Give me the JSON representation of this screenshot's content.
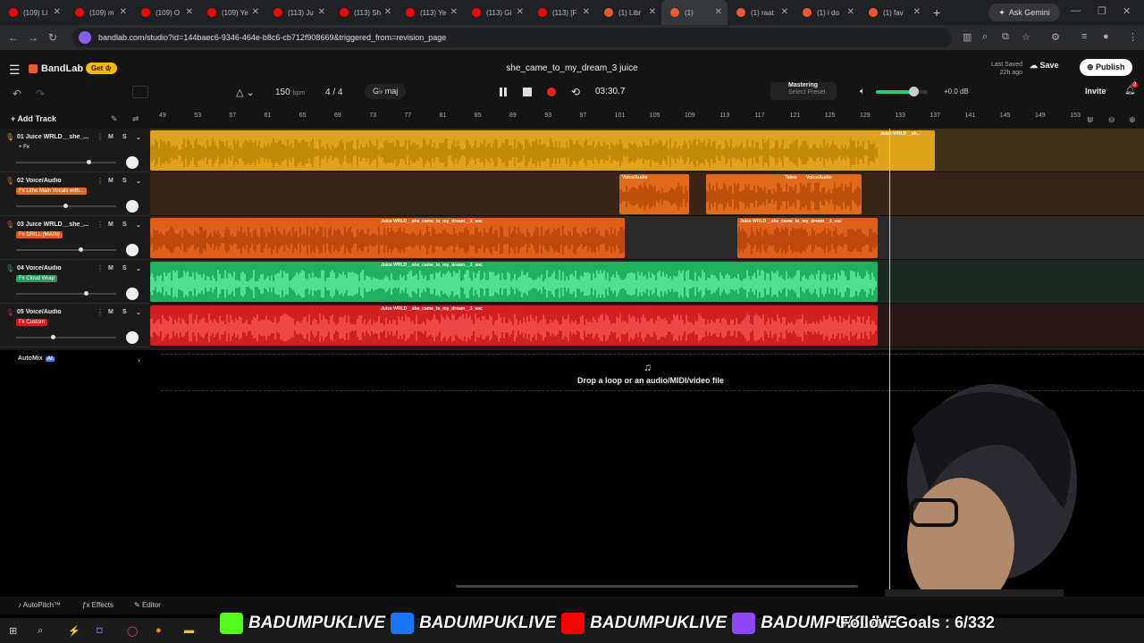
{
  "browser": {
    "tabs": [
      {
        "label": "(109) Li",
        "color": "#ff0000"
      },
      {
        "label": "(109) m",
        "color": "#ff0000"
      },
      {
        "label": "(109) O",
        "color": "#ff0000"
      },
      {
        "label": "(109) Ye",
        "color": "#ff0000"
      },
      {
        "label": "(113) Ju",
        "color": "#ff0000"
      },
      {
        "label": "(113) Sh",
        "color": "#ff0000"
      },
      {
        "label": "(113) Ye",
        "color": "#ff0000"
      },
      {
        "label": "(113) Gi",
        "color": "#ff0000"
      },
      {
        "label": "(113) [F",
        "color": "#ff0000"
      },
      {
        "label": "(1) Libr",
        "color": "#f2572d"
      },
      {
        "label": "(1)",
        "color": "#f2572d"
      },
      {
        "label": "(1) raat",
        "color": "#f2572d"
      },
      {
        "label": "(1) i do",
        "color": "#f2572d"
      },
      {
        "label": "(1) fav",
        "color": "#f2572d"
      }
    ],
    "new_tab": "+",
    "gemini": "Ask Gemini",
    "url": "bandlab.com/studio?id=144baec6-9346-464e-b8c6-cb712f908669&triggered_from=revision_page"
  },
  "app": {
    "brand": "BandLab",
    "get_label": "Get",
    "song_title": "she_came_to_my_dream_3 juice",
    "last_saved": "Last Saved",
    "last_saved_time": "22h ago",
    "save_label": "Save",
    "publish_label": "Publish",
    "invite_label": "Invite",
    "notif_count": "2"
  },
  "toolbar": {
    "bpm": "150",
    "bpm_unit": "bpm",
    "time_signature": "4 / 4",
    "key": "G♭ maj",
    "timecode": "03:30.7",
    "mastering_title": "Mastering",
    "mastering_preset": "Select Preset",
    "volume_reading": "+0.0 dB",
    "volume_level": 0.72
  },
  "ruler": [
    "49",
    "53",
    "57",
    "61",
    "65",
    "69",
    "73",
    "77",
    "81",
    "85",
    "89",
    "93",
    "97",
    "101",
    "105",
    "109",
    "113",
    "117",
    "121",
    "125",
    "129",
    "133",
    "137",
    "141",
    "145",
    "149",
    "153"
  ],
  "tracks_header": {
    "add_track": "Add Track"
  },
  "tracks": [
    {
      "num": "01",
      "name": "Juice WRLD__she_...",
      "fx": "+ Fx",
      "fx_color": "transparent",
      "lane_color": "#e0a21a",
      "mic_color": "#e0a21a",
      "volume": 0.72
    },
    {
      "num": "02",
      "name": "Voice/Audio",
      "fx": "Fx Lithe Main Vocals with...",
      "fx_color": "#e06a1a",
      "lane_color": "#e06a1a",
      "mic_color": "#e06a1a",
      "volume": 0.49
    },
    {
      "num": "03",
      "name": "Juice WRLD__she_...",
      "fx": "Fx DRILL (MAIN)",
      "fx_color": "#e05a1a",
      "lane_color": "#e0601a",
      "mic_color": "#e0601a",
      "volume": 0.64
    },
    {
      "num": "04",
      "name": "Voice/Audio",
      "fx": "Fx Cloud Wrap",
      "fx_color": "#20a060",
      "lane_color": "#20b060",
      "mic_color": "#20b060",
      "volume": 0.7
    },
    {
      "num": "05",
      "name": "Voice/Audio",
      "fx": "Fx Custom",
      "fx_color": "#d02020",
      "lane_color": "#d02020",
      "mic_color": "#d02020",
      "volume": 0.37
    }
  ],
  "clips": {
    "t1": "Juice WRLD__sh...",
    "t2a": "Voice/Audio",
    "t2b": "Takes",
    "t2c": "Voice/Audio",
    "t3a": "Juice WRLD__she_came_to_my_dream__3_voc",
    "t3b": "Juice WRLD__she_came_to_my_dream__3_voc",
    "t4": "Juice WRLD__she_came_to_my_dream__3_voc",
    "t5": "Juice WRLD__she_came_to_my_dream__3_voc"
  },
  "automix": {
    "label": "AutoMix",
    "badge": "AI"
  },
  "drop": {
    "text": "Drop a loop or an audio/MIDI/video file"
  },
  "bottom": {
    "autopitch": "AutoPitch™",
    "effects": "Effects",
    "editor": "Editor"
  },
  "overlay": {
    "handle1": "BADUMPUKLIVE",
    "handle2": "BADUMPUKLIVE",
    "handle3": "BADUMPUKLIVE",
    "handle4": "BADUMPUKLIVE",
    "follow_goals": "Follow Goals : 6/332"
  }
}
